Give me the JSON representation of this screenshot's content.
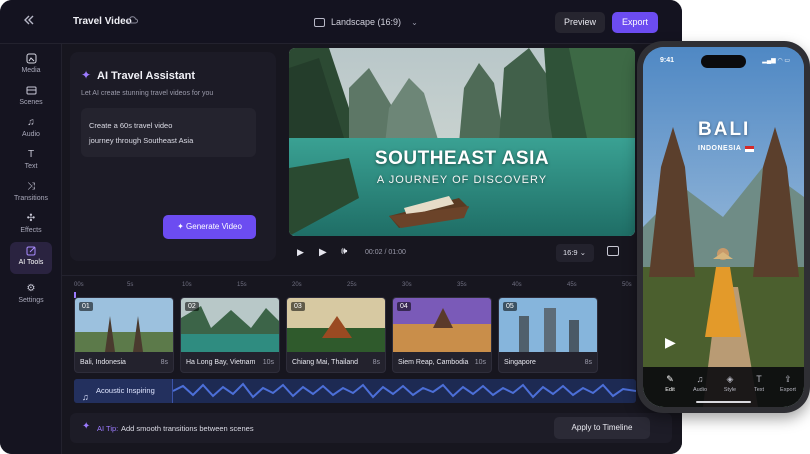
{
  "header": {
    "title": "Travel Video",
    "aspect_label": "Landscape (16:9)",
    "preview_label": "Preview",
    "export_label": "Export"
  },
  "sidebar": {
    "items": [
      {
        "label": "Media",
        "icon": "media-icon"
      },
      {
        "label": "Scenes",
        "icon": "scenes-icon"
      },
      {
        "label": "Audio",
        "icon": "music-note-icon"
      },
      {
        "label": "Text",
        "icon": "text-icon"
      },
      {
        "label": "Transitions",
        "icon": "transitions-icon"
      },
      {
        "label": "Effects",
        "icon": "effects-icon"
      },
      {
        "label": "AI Tools",
        "icon": "ai-tools-icon"
      },
      {
        "label": "Settings",
        "icon": "gear-icon"
      }
    ]
  },
  "assistant": {
    "title": "AI Travel Assistant",
    "subtitle": "Let AI create stunning travel videos for you",
    "prompt_line1": "Create a 60s travel video",
    "prompt_line2": "journey through Southeast Asia",
    "generate_label": "Generate Video"
  },
  "preview": {
    "title": "SOUTHEAST ASIA",
    "subtitle": "A JOURNEY OF DISCOVERY",
    "time": "00:02 / 01:00",
    "ratio": "16:9"
  },
  "timeline": {
    "ruler": [
      "00s",
      "5s",
      "10s",
      "15s",
      "20s",
      "25s",
      "30s",
      "35s",
      "40s",
      "45s",
      "50s"
    ],
    "clips": [
      {
        "num": "01",
        "name": "Bali, Indonesia",
        "duration": "8s"
      },
      {
        "num": "02",
        "name": "Ha Long Bay, Vietnam",
        "duration": "10s"
      },
      {
        "num": "03",
        "name": "Chiang Mai, Thailand",
        "duration": "8s"
      },
      {
        "num": "04",
        "name": "Siem Reap, Cambodia",
        "duration": "10s"
      },
      {
        "num": "05",
        "name": "Singapore",
        "duration": "8s"
      }
    ],
    "audio_track": "Acoustic Inspiring"
  },
  "tip": {
    "prefix": "AI Tip:",
    "text": "Add smooth transitions between scenes",
    "button_label": "Apply to Timeline"
  },
  "phone": {
    "time": "9:41",
    "title": "BALI",
    "subtitle": "INDONESIA",
    "nav": [
      {
        "label": "Edit",
        "icon": "pencil-icon"
      },
      {
        "label": "Audio",
        "icon": "music-note-icon"
      },
      {
        "label": "Style",
        "icon": "palette-icon"
      },
      {
        "label": "Text",
        "icon": "text-icon"
      },
      {
        "label": "Export",
        "icon": "export-icon"
      }
    ]
  },
  "colors": {
    "accent": "#6c4cf1",
    "background": "#17161f",
    "audio_track": "#1d2a53"
  }
}
